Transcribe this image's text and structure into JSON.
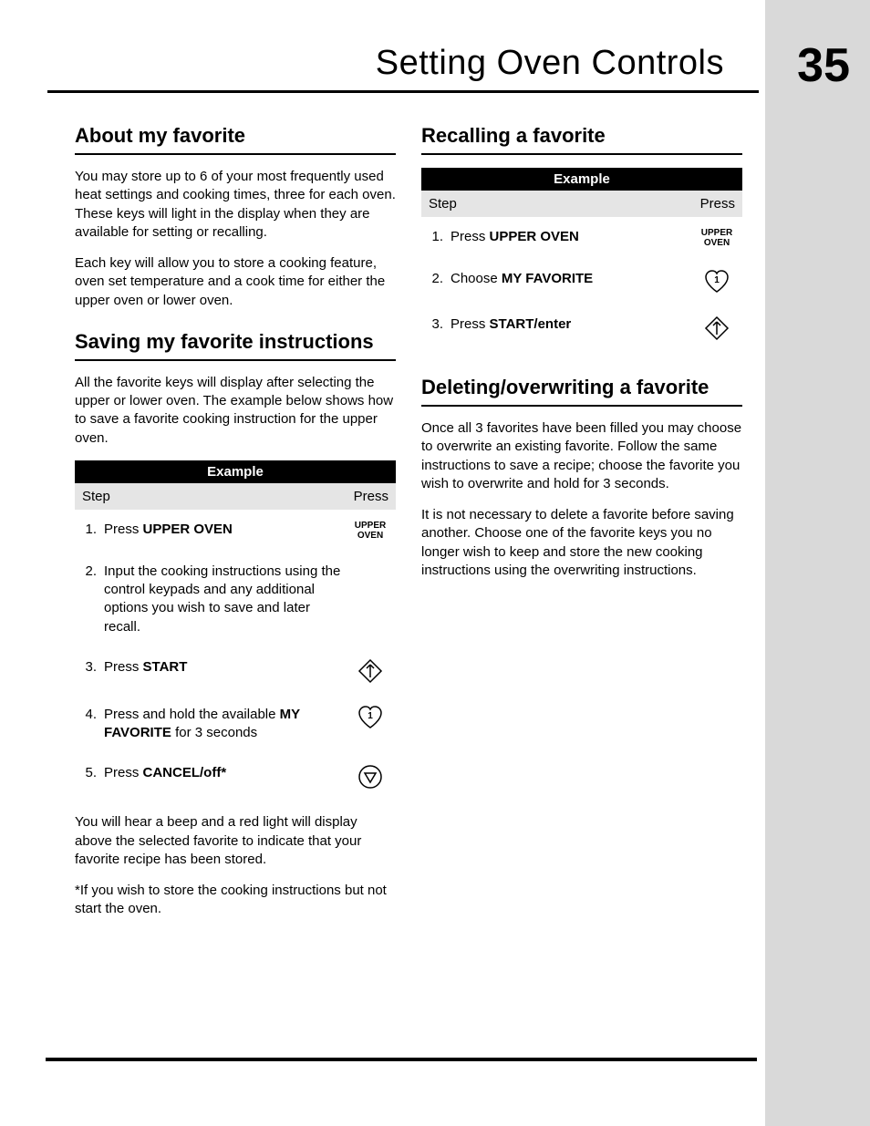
{
  "header": {
    "title": "Setting Oven Controls",
    "page_number": "35"
  },
  "left": {
    "about": {
      "heading": "About my favorite",
      "p1": "You may store up to 6 of your most frequently used heat settings and cooking times, three for each oven. These keys will light in the display when they are available for setting or recalling.",
      "p2": "Each key will allow you to store a cooking feature, oven set temperature and a cook time for either the upper oven or lower oven."
    },
    "saving": {
      "heading": "Saving my favorite instructions",
      "intro": "All the favorite keys will display after selecting the upper or lower oven. The example below shows how to save a favorite cooking instruction for the upper oven.",
      "table": {
        "title": "Example",
        "col_step": "Step",
        "col_press": "Press",
        "rows": [
          {
            "num": "1.",
            "pre": "Press ",
            "bold": "UPPER OVEN",
            "post": "",
            "icon": "upper-oven"
          },
          {
            "num": "2.",
            "pre": "",
            "bold": "",
            "post": "Input the cooking instructions using the control keypads and any additional options you wish to save and later recall.",
            "icon": ""
          },
          {
            "num": "3.",
            "pre": "Press ",
            "bold": "START",
            "post": "",
            "icon": "start"
          },
          {
            "num": "4.",
            "pre": "Press and hold the available ",
            "bold": "MY FAVORITE",
            "post": " for 3 seconds",
            "icon": "favorite"
          },
          {
            "num": "5.",
            "pre": "Press ",
            "bold": "CANCEL/off*",
            "post": "",
            "icon": "cancel"
          }
        ]
      },
      "after1": "You will hear a beep and a red light will display above the selected favorite to indicate that your favorite recipe has been stored.",
      "after2": "*If you wish to store the cooking instructions but not start the oven."
    }
  },
  "right": {
    "recall": {
      "heading": "Recalling a favorite",
      "table": {
        "title": "Example",
        "col_step": "Step",
        "col_press": "Press",
        "rows": [
          {
            "num": "1.",
            "pre": "Press ",
            "bold": "UPPER OVEN",
            "post": "",
            "icon": "upper-oven"
          },
          {
            "num": "2.",
            "pre": "Choose ",
            "bold": "MY FAVORITE",
            "post": "",
            "icon": "favorite"
          },
          {
            "num": "3.",
            "pre": "Press ",
            "bold": "START/enter",
            "post": "",
            "icon": "start"
          }
        ]
      }
    },
    "delete": {
      "heading": "Deleting/overwriting a favorite",
      "p1": "Once all 3 favorites have been filled you may choose to overwrite an existing favorite. Follow the same instructions to save a recipe; choose the favorite you wish to overwrite and hold for 3 seconds.",
      "p2": "It is not necessary to delete a favorite before saving another. Choose one of the favorite keys you no longer wish to keep and store the new cooking instructions using the overwriting instructions."
    }
  },
  "icons": {
    "upper-oven": "UPPER\nOVEN"
  }
}
